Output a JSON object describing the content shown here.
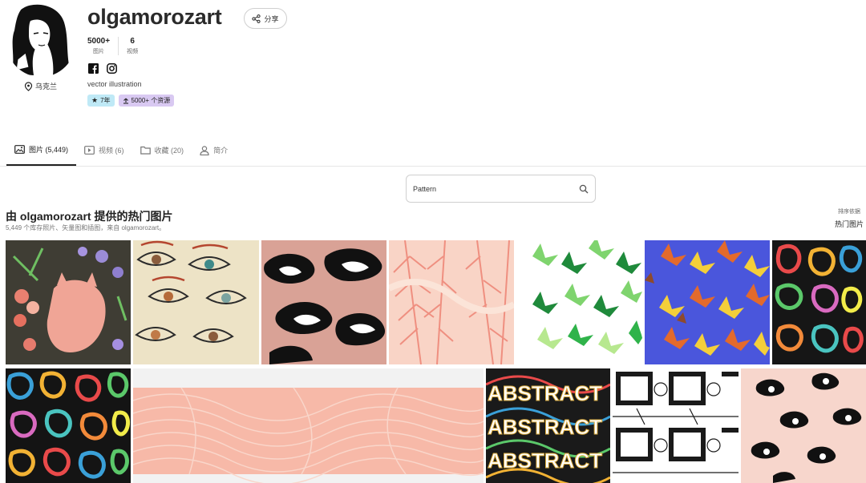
{
  "profile": {
    "username": "olgamorozart",
    "share_label": "分享",
    "location": "乌克兰",
    "stats": [
      {
        "value": "5000+",
        "label": "图片"
      },
      {
        "value": "6",
        "label": "视频"
      }
    ],
    "bio": "vector illustration",
    "badges": {
      "years": "7年",
      "resources": "5000+ 个资源"
    }
  },
  "tabs": [
    {
      "label": "图片 (5,449)",
      "icon": "image-icon",
      "active": true
    },
    {
      "label": "视频 (6)",
      "icon": "video-icon",
      "active": false
    },
    {
      "label": "收藏 (20)",
      "icon": "folder-icon",
      "active": false
    },
    {
      "label": "简介",
      "icon": "user-icon",
      "active": false
    }
  ],
  "search": {
    "value": "Pattern"
  },
  "section": {
    "title": "由 olgamorozart 提供的热门图片",
    "subtitle": "5,449 个库存照片、矢量图和插图，来自 olgamorozart。",
    "sort_label": "排序依据",
    "sort_value": "热门图片"
  },
  "colors": {
    "accent_teal": "#bfe9f6",
    "accent_purple": "#d9c9f2"
  }
}
